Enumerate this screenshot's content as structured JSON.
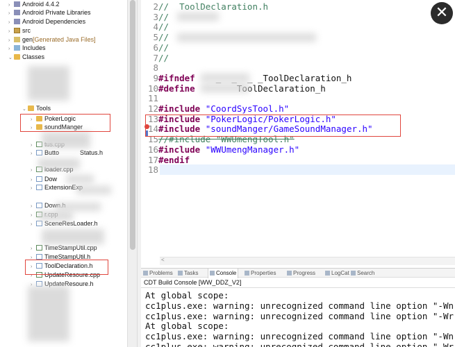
{
  "explorer": {
    "items": [
      {
        "label": "Android 4.4.2",
        "icon": "library-icon"
      },
      {
        "label": "Android Private Libraries",
        "icon": "library-icon"
      },
      {
        "label": "Android Dependencies",
        "icon": "library-icon"
      },
      {
        "label": "src",
        "icon": "source-folder-icon"
      },
      {
        "label": "gen",
        "suffix": "[Generated Java Files]",
        "icon": "generated-folder-icon"
      },
      {
        "label": "Includes",
        "icon": "includes-icon"
      },
      {
        "label": "Classes",
        "icon": "folder-icon"
      },
      {
        "label": "Tools",
        "icon": "folder-icon"
      },
      {
        "label": "PokerLogic",
        "icon": "folder-icon"
      },
      {
        "label": "soundManger",
        "icon": "folder-icon"
      },
      {
        "label": "Butto",
        "suffix": "Status.h",
        "icon": "header-file-icon"
      },
      {
        "label": "loader.cpp",
        "icon": "cpp-file-icon"
      },
      {
        "label": "Dow",
        "icon": "header-file-icon"
      },
      {
        "label": "ExtensionExp",
        "icon": "header-file-icon"
      },
      {
        "label": "Down.h",
        "icon": "header-file-icon"
      },
      {
        "label": "r.cpp",
        "icon": "cpp-file-icon"
      },
      {
        "label": "SceneResLoader.h",
        "icon": "header-file-icon"
      },
      {
        "label": "TimeStampUtil.cpp",
        "icon": "cpp-file-icon"
      },
      {
        "label": "TimeStampUtil.h",
        "icon": "header-file-icon"
      },
      {
        "label": "ToolDeclaration.h",
        "icon": "header-file-icon"
      },
      {
        "label": "UpdateResoure.cpp",
        "icon": "cpp-file-icon"
      },
      {
        "label": "UpdateResoure.h",
        "icon": "header-file-icon"
      },
      {
        "label": "tus.cpp",
        "icon": "cpp-file-icon"
      }
    ]
  },
  "editor": {
    "lines": [
      {
        "no": "2",
        "parts": [
          {
            "t": "//  ToolDeclaration.h",
            "c": "comment"
          }
        ]
      },
      {
        "no": "3",
        "parts": [
          {
            "t": "//",
            "c": "comment"
          }
        ]
      },
      {
        "no": "4",
        "parts": [
          {
            "t": "//",
            "c": "comment"
          }
        ]
      },
      {
        "no": "5",
        "parts": [
          {
            "t": "//",
            "c": "comment"
          }
        ]
      },
      {
        "no": "6",
        "parts": [
          {
            "t": "//",
            "c": "comment"
          }
        ]
      },
      {
        "no": "7",
        "parts": [
          {
            "t": "//",
            "c": "comment"
          }
        ]
      },
      {
        "no": "8",
        "parts": []
      },
      {
        "no": "9",
        "parts": [
          {
            "t": "#ifndef",
            "c": "kw"
          },
          {
            "t": "    _  _  _ _ToolDeclaration_h",
            "c": "plain"
          }
        ]
      },
      {
        "no": "10",
        "parts": [
          {
            "t": "#define",
            "c": "kw"
          },
          {
            "t": "        ToolDeclaration_h",
            "c": "plain"
          }
        ]
      },
      {
        "no": "11",
        "parts": []
      },
      {
        "no": "12",
        "parts": [
          {
            "t": "#include",
            "c": "kw"
          },
          {
            "t": " ",
            "c": "plain"
          },
          {
            "t": "\"CoordSysTool.h\"",
            "c": "str"
          }
        ]
      },
      {
        "no": "13",
        "parts": [
          {
            "t": "#include",
            "c": "kw"
          },
          {
            "t": " ",
            "c": "plain"
          },
          {
            "t": "\"PokerLogic/PokerLogic.h\"",
            "c": "str"
          }
        ]
      },
      {
        "no": "14",
        "parts": [
          {
            "t": "#include",
            "c": "kw"
          },
          {
            "t": " ",
            "c": "plain"
          },
          {
            "t": "\"soundManger/GameSoundManager.h\"",
            "c": "str"
          }
        ]
      },
      {
        "no": "15",
        "parts": [
          {
            "t": "//#include \"WWUmengTool.h\"",
            "c": "struck"
          }
        ]
      },
      {
        "no": "16",
        "parts": [
          {
            "t": "#include",
            "c": "kw"
          },
          {
            "t": " ",
            "c": "plain"
          },
          {
            "t": "\"WWUmengManager.h\"",
            "c": "str"
          }
        ]
      },
      {
        "no": "17",
        "parts": [
          {
            "t": "#endif",
            "c": "kw"
          }
        ]
      },
      {
        "no": "18",
        "parts": []
      }
    ]
  },
  "bottom": {
    "tabs": [
      "Problems",
      "Tasks",
      "Console",
      "Properties",
      "Progress",
      "LogCat",
      "Search"
    ],
    "console_title": "CDT Build Console [WW_DDZ_V2]",
    "console_lines": [
      "At global scope:",
      "cc1plus.exe: warning: unrecognized command line option \"-Wn",
      "cc1plus.exe: warning: unrecognized command line option \"-Wr",
      "At global scope:",
      "cc1plus.exe: warning: unrecognized command line option \"-Wn",
      "cc1plus.exe: warning: unrecognized command line option \"-Wr"
    ]
  },
  "overlay": {
    "close_glyph": "✕"
  }
}
